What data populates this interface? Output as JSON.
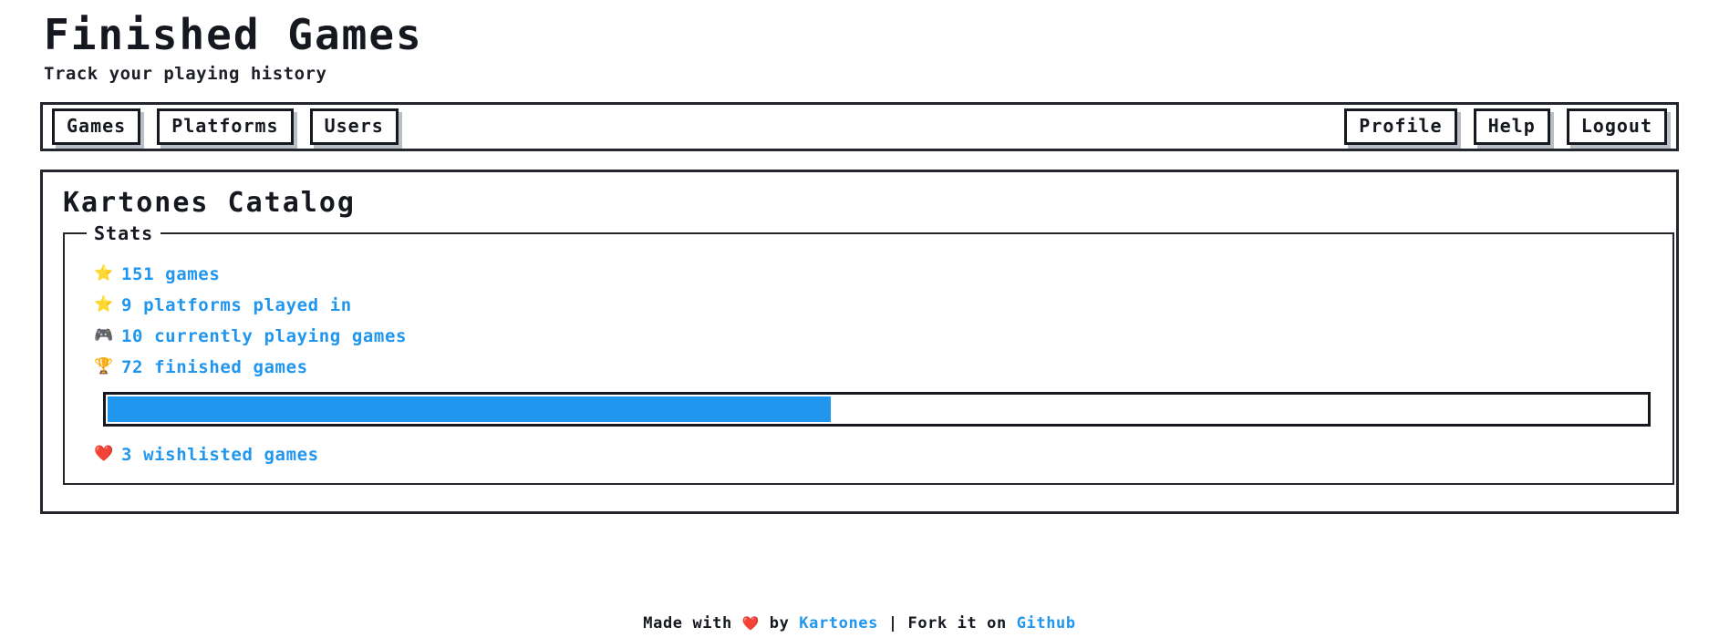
{
  "header": {
    "title": "Finished Games",
    "subtitle": "Track your playing history"
  },
  "nav": {
    "left_items": [
      {
        "label": "Games",
        "name": "nav-button-games"
      },
      {
        "label": "Platforms",
        "name": "nav-button-platforms"
      },
      {
        "label": "Users",
        "name": "nav-button-users"
      }
    ],
    "right_items": [
      {
        "label": "Profile",
        "name": "nav-button-profile"
      },
      {
        "label": "Help",
        "name": "nav-button-help"
      },
      {
        "label": "Logout",
        "name": "nav-button-logout"
      }
    ]
  },
  "panel": {
    "title": "Kartones Catalog",
    "stats_legend": "Stats",
    "stats": [
      {
        "icon": "star-icon",
        "glyph": "⭐",
        "count": "151",
        "label": "games"
      },
      {
        "icon": "star-icon",
        "glyph": "⭐",
        "count": "9",
        "label": "platforms played in"
      },
      {
        "icon": "gamepad-icon",
        "glyph": "🎮",
        "count": "10",
        "label": "currently playing games"
      },
      {
        "icon": "trophy-icon",
        "glyph": "🏆",
        "count": "72",
        "label": "finished games"
      }
    ],
    "progress": {
      "percent": 47,
      "percent_label": "47%",
      "fill_color": "#2196ef"
    },
    "wishlist": {
      "icon": "heart-icon",
      "glyph": "❤️",
      "count": "3",
      "label": "wishlisted games"
    }
  },
  "footer": {
    "made_with": "Made with",
    "heart_glyph": "❤️",
    "by": "by",
    "author": "Kartones",
    "separator": "|",
    "fork_text": "Fork it on",
    "repo": "Github"
  },
  "colors": {
    "accent_blue": "#2196ef",
    "ink": "#15181f",
    "shadow_gray": "#b9bec7"
  }
}
